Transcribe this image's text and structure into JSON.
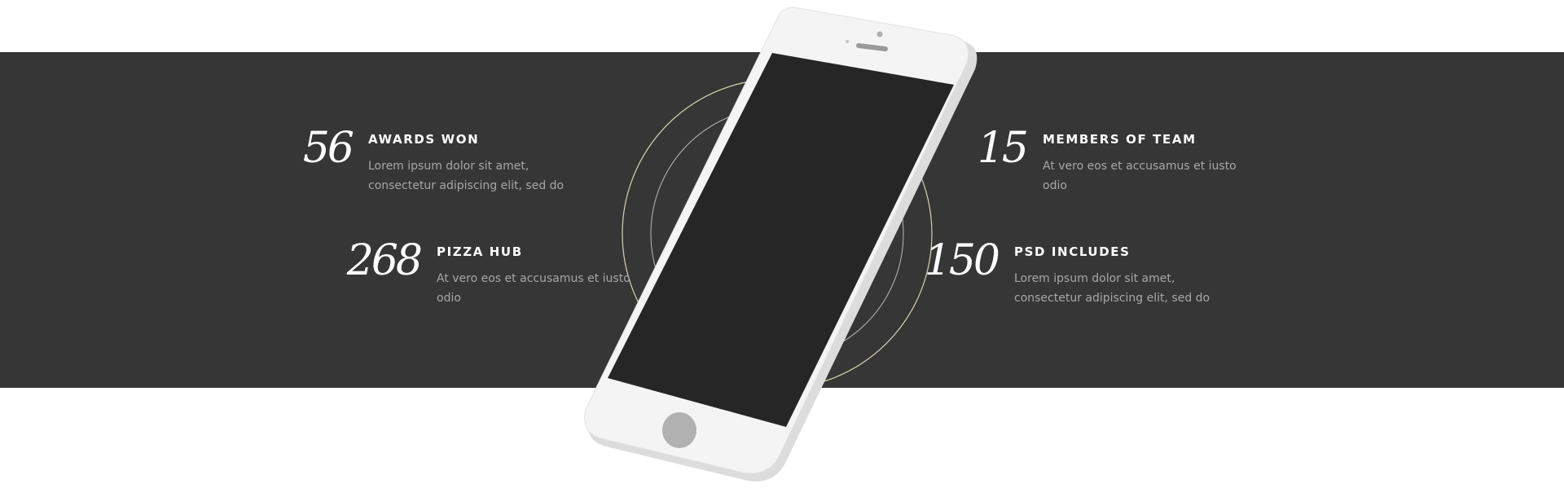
{
  "stats": [
    {
      "number": "56",
      "title": "AWARDS WON",
      "desc": "Lorem ipsum dolor sit amet, consectetur adipiscing elit, sed do"
    },
    {
      "number": "268",
      "title": "PIZZA HUB",
      "desc": "At vero eos et accusamus et iusto odio"
    },
    {
      "number": "15",
      "title": "MEMBERS OF TEAM",
      "desc": "At vero eos et accusamus et iusto odio"
    },
    {
      "number": "150",
      "title": "PSD INCLUDES",
      "desc": "Lorem ipsum dolor sit amet, consectetur adipiscing elit, sed do"
    }
  ],
  "colors": {
    "band": "#363636",
    "ring": "#d8d3b0",
    "phone_body": "#f4f4f4",
    "phone_screen": "#262626",
    "text_muted": "#a7a7a7"
  },
  "icons": [
    "decorative-ring-icon",
    "smartphone-mockup-icon",
    "home-button-icon",
    "earpiece-icon",
    "front-camera-icon"
  ]
}
